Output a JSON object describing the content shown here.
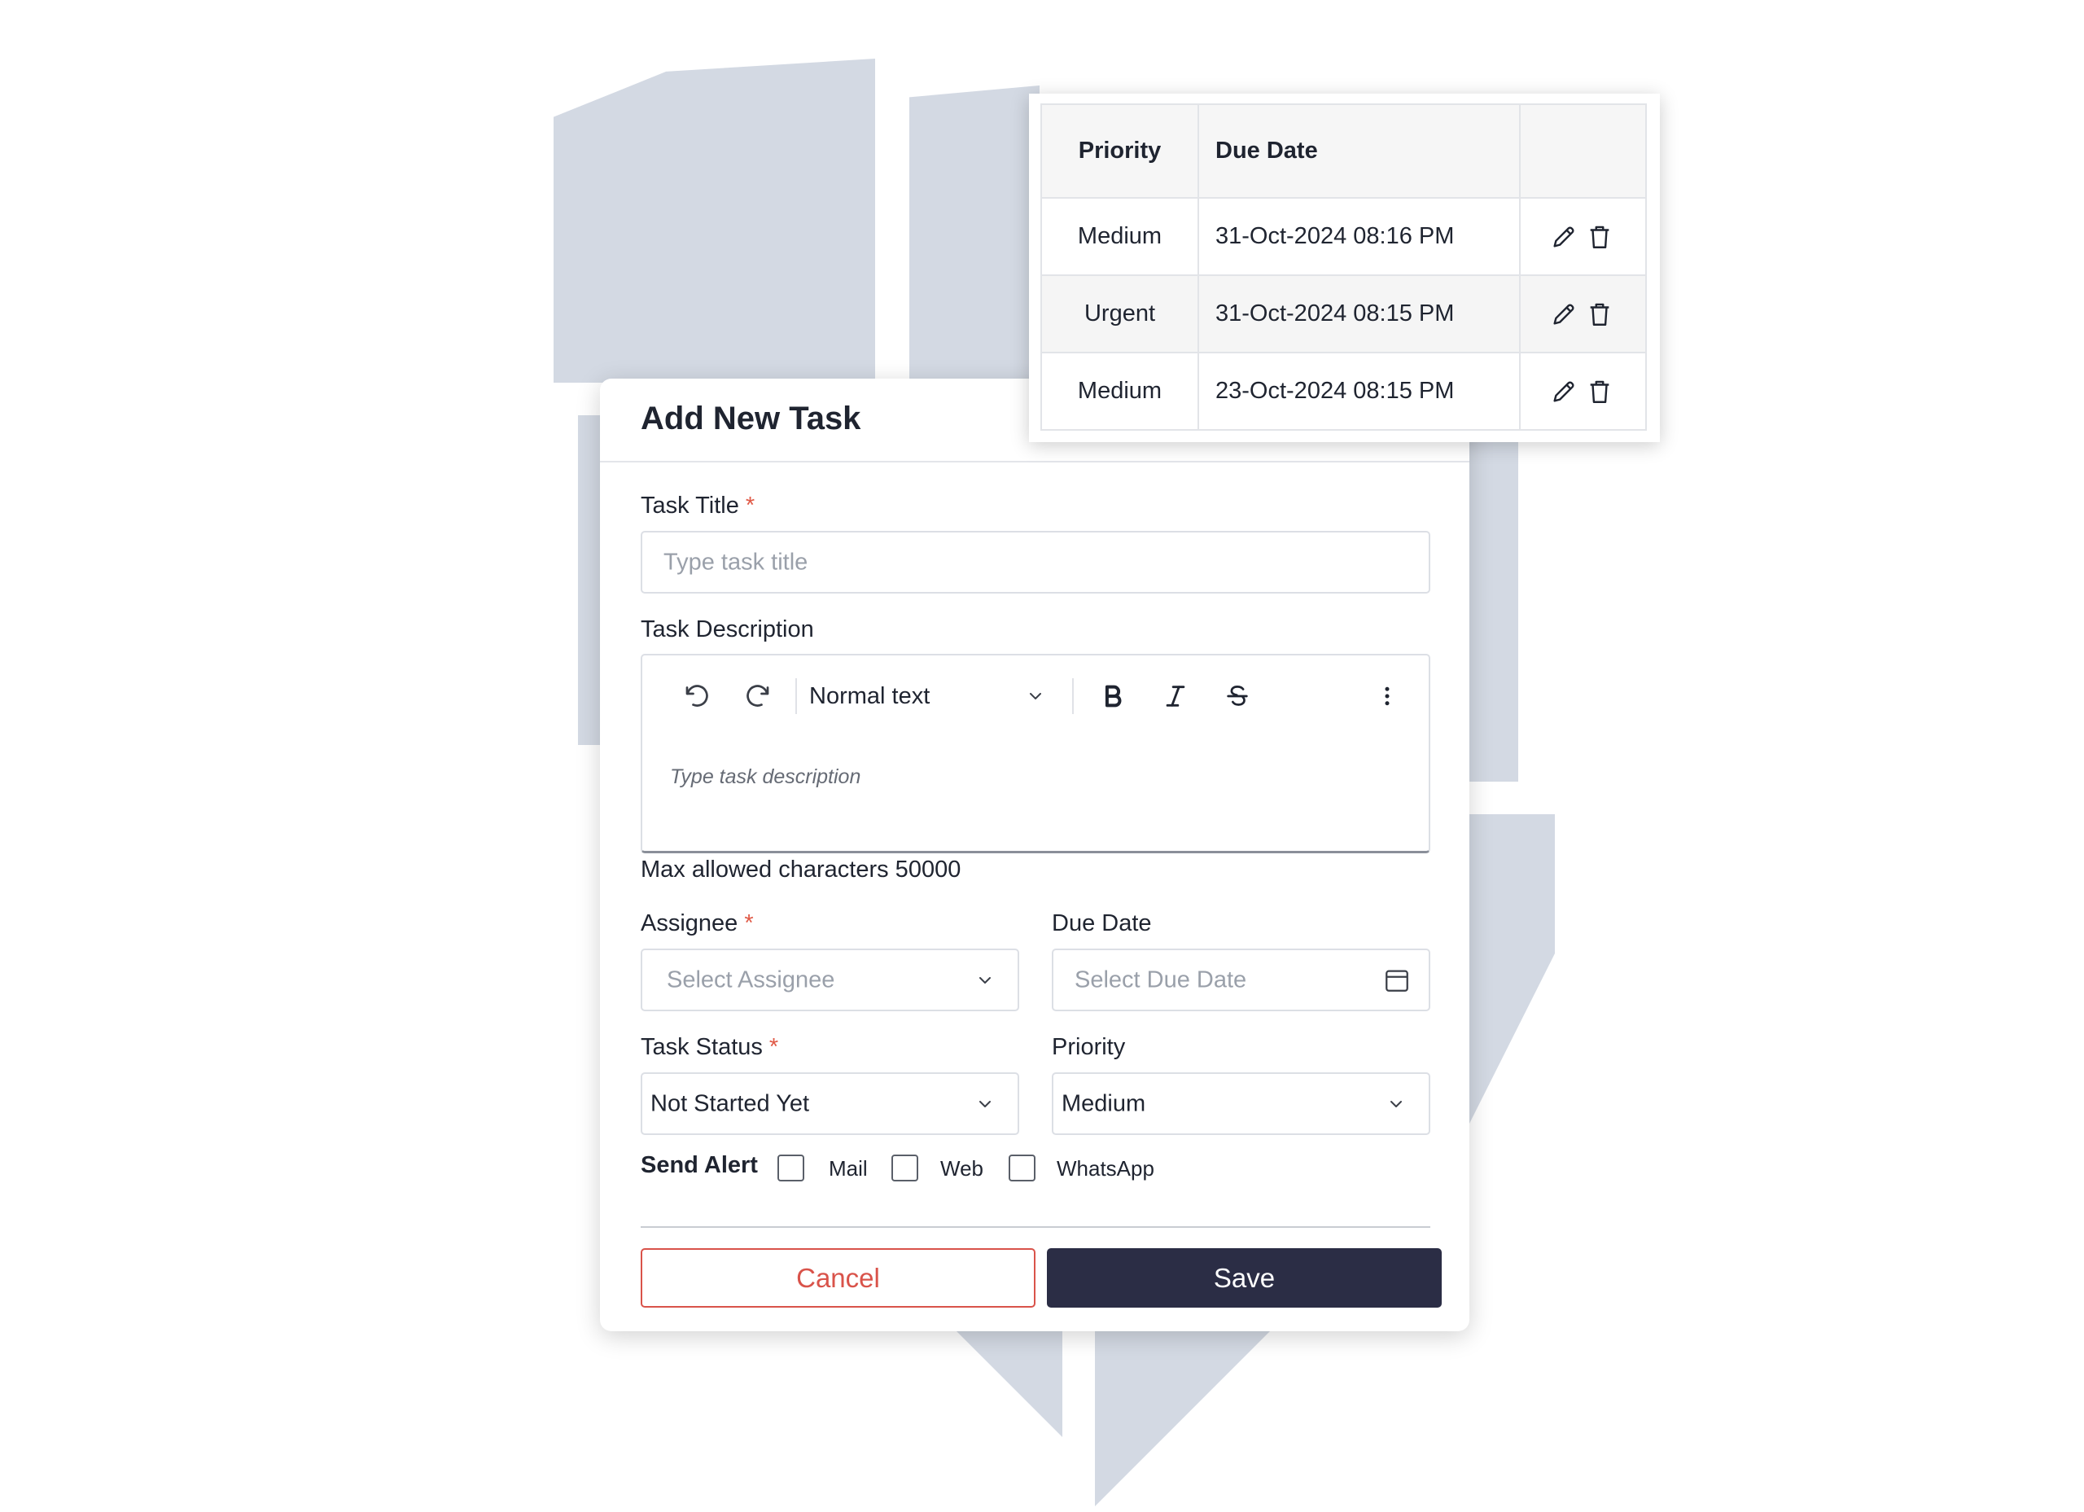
{
  "modal": {
    "title": "Add New Task",
    "task_title": {
      "label": "Task Title",
      "required_mark": "*",
      "placeholder": "Type task title",
      "value": ""
    },
    "task_description": {
      "label": "Task Description",
      "toolbar": {
        "text_style": "Normal text",
        "icons": [
          "undo-icon",
          "redo-icon",
          "chevron-down-icon",
          "bold-icon",
          "italic-icon",
          "strikethrough-icon",
          "more-vertical-icon"
        ]
      },
      "placeholder": "Type task description",
      "note": "Max allowed characters 50000"
    },
    "assignee": {
      "label": "Assignee",
      "required_mark": "*",
      "placeholder": "Select Assignee"
    },
    "due_date": {
      "label": "Due Date",
      "placeholder": "Select Due Date"
    },
    "task_status": {
      "label": "Task Status",
      "required_mark": "*",
      "value": "Not Started Yet"
    },
    "priority": {
      "label": "Priority",
      "value": "Medium"
    },
    "send_alert": {
      "label": "Send Alert",
      "options": [
        {
          "label": "Mail",
          "checked": false
        },
        {
          "label": "Web",
          "checked": false
        },
        {
          "label": "WhatsApp",
          "checked": false
        }
      ]
    },
    "cancel_label": "Cancel",
    "save_label": "Save"
  },
  "task_table": {
    "headers": [
      "Priority",
      "Due Date",
      ""
    ],
    "rows": [
      {
        "priority": "Medium",
        "due_date": "31-Oct-2024 08:16 PM"
      },
      {
        "priority": "Urgent",
        "due_date": "31-Oct-2024 08:15 PM"
      },
      {
        "priority": "Medium",
        "due_date": "23-Oct-2024 08:15 PM"
      }
    ]
  },
  "colors": {
    "accent_dark": "#2b2d45",
    "cancel_red": "#d9534a",
    "required_red": "#e05a47",
    "background_shape": "#d3d9e3"
  }
}
